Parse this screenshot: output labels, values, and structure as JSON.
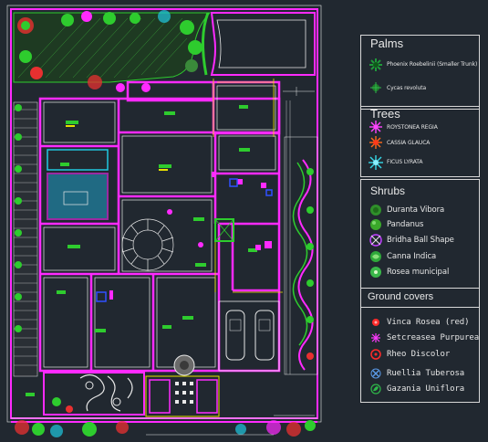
{
  "legend": {
    "palms": {
      "title": "Palms",
      "items": [
        {
          "label": "Phoenix Roebelinii (Smaller Trunk)",
          "color": "#1f7a2a",
          "icon": "palm-star-icon"
        },
        {
          "label": "Cycas revoluta",
          "color": "#1f9a3a",
          "icon": "palm-small-icon"
        }
      ]
    },
    "trees": {
      "title": "Trees",
      "items": [
        {
          "label": "ROYSTONEA REGIA",
          "color": "#ff44ff",
          "icon": "tree-starburst-magenta-icon"
        },
        {
          "label": "CASSIA GLAUCA",
          "color": "#ff6a1a",
          "icon": "tree-starburst-orange-icon"
        },
        {
          "label": "FICUS LYRATA",
          "color": "#34d8e8",
          "icon": "tree-starburst-cyan-icon"
        }
      ]
    },
    "shrubs": {
      "title": "Shrubs",
      "items": [
        {
          "label": "Duranta Vibora",
          "color": "#2f8f2a",
          "icon": "shrub-round-icon"
        },
        {
          "label": "Pandanus",
          "color": "#3aa82a",
          "icon": "shrub-leafy-icon"
        },
        {
          "label": "Bridha Ball Shape",
          "color": "#c040ff",
          "icon": "shrub-ball-icon"
        },
        {
          "label": "Canna Indica",
          "color": "#2fa83a",
          "icon": "shrub-canna-icon"
        },
        {
          "label": "Rosea municipal",
          "color": "#3ab84a",
          "icon": "shrub-rose-icon"
        }
      ]
    },
    "ground_covers": {
      "title": "Ground covers",
      "items": [
        {
          "label": "Vinca Rosea (red)",
          "color": "#ff2a2a",
          "icon": "groundcover-dot-icon"
        },
        {
          "label": "Setcreasea Purpurea",
          "color": "#ff3aff",
          "icon": "groundcover-burst-icon"
        },
        {
          "label": "Rheo Discolor",
          "color": "#ff2a2a",
          "icon": "groundcover-ring-icon"
        },
        {
          "label": "Ruellia Tuberosa",
          "color": "#5a9ae8",
          "icon": "groundcover-cross-icon"
        },
        {
          "label": "Gazania Uniflora",
          "color": "#2fb84a",
          "icon": "groundcover-leaf-icon"
        }
      ]
    }
  },
  "colors": {
    "background": "#212830",
    "walls": "#ff2aff",
    "magenta": "#ff2aff",
    "green": "#2ecc2e",
    "yellow": "#e8e000",
    "white": "#e8e8e8",
    "red": "#e83030",
    "cyan": "#20c8e0",
    "blue": "#3050ff",
    "lawn": "#3a8a3a"
  }
}
